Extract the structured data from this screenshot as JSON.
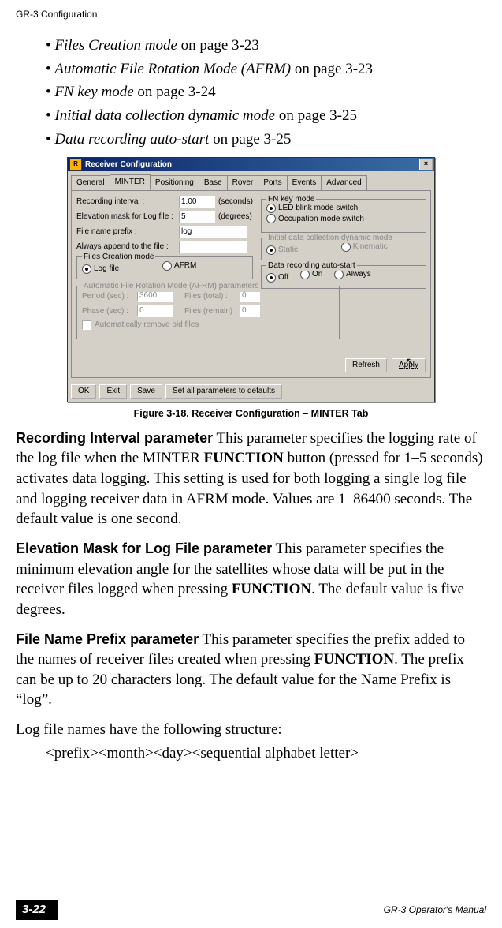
{
  "header": {
    "running": "GR-3 Configuration"
  },
  "bullets": [
    {
      "term": "Files Creation mode",
      "rest": " on page 3-23"
    },
    {
      "term": "Automatic File Rotation Mode (AFRM)",
      "rest": " on page 3-23"
    },
    {
      "term": "FN key mode",
      "rest": " on page 3-24"
    },
    {
      "term": "Initial data collection dynamic mode",
      "rest": " on page 3-25"
    },
    {
      "term": "Data recording auto-start",
      "rest": " on page 3-25"
    }
  ],
  "dialog": {
    "title": "Receiver Configuration",
    "close": "×",
    "tabs": [
      "General",
      "MINTER",
      "Positioning",
      "Base",
      "Rover",
      "Ports",
      "Events",
      "Advanced"
    ],
    "active_tab": 1,
    "left": {
      "rec_int_lbl": "Recording interval :",
      "rec_int_val": "1.00",
      "rec_int_unit": "(seconds)",
      "elev_lbl": "Elevation mask for Log file :",
      "elev_val": "5",
      "elev_unit": "(degrees)",
      "prefix_lbl": "File name prefix :",
      "prefix_val": "log",
      "append_lbl": "Always append to the file :",
      "append_val": ""
    },
    "files_creation": {
      "legend": "Files Creation mode",
      "opt1": "Log file",
      "opt2": "AFRM"
    },
    "afrm": {
      "legend": "Automatic File Rotation Mode (AFRM) parameters",
      "period_lbl": "Period (sec) :",
      "period_val": "3600",
      "total_lbl": "Files (total) :",
      "total_val": "0",
      "phase_lbl": "Phase (sec) :",
      "phase_val": "0",
      "remain_lbl": "Files (remain) :",
      "remain_val": "0",
      "auto_remove": "Automatically remove old files"
    },
    "fn": {
      "legend": "FN key mode",
      "opt1": "LED blink mode switch",
      "opt2": "Occupation mode switch"
    },
    "initdyn": {
      "legend": "Initial data collection dynamic mode",
      "opt1": "Static",
      "opt2": "Kinematic"
    },
    "autostart": {
      "legend": "Data recording auto-start",
      "opt1": "Off",
      "opt2": "On",
      "opt3": "Always"
    },
    "refresh": "Refresh",
    "apply": "Apply",
    "bottom": {
      "ok": "OK",
      "exit": "Exit",
      "save": "Save",
      "defaults": "Set all parameters to defaults"
    }
  },
  "caption": "Figure 3-18. Receiver Configuration – MINTER Tab",
  "p1": {
    "lead": "Recording Interval parameter",
    "t1": " This parameter specifies the logging rate of the log file when the MINTER ",
    "b1": "FUNCTION",
    "t2": " button (pressed for 1–5 seconds) activates data logging. This setting is used for both logging a single log file and logging receiver data in AFRM mode. Values are 1–86400 seconds. The default value is one second."
  },
  "p2": {
    "lead": "Elevation Mask for Log File parameter",
    "t1": " This parameter specifies the minimum elevation angle for the satellites whose data will be put in the receiver files logged when pressing ",
    "b1": "FUNCTION",
    "t2": ". The default value is five degrees."
  },
  "p3": {
    "lead": "File Name Prefix parameter",
    "t1": " This parameter specifies the prefix added to the names of receiver files created when pressing ",
    "b1": "FUNCTION",
    "t2": ". The prefix can be up to 20 characters long. The default value for the Name Prefix is “log”."
  },
  "p4": "Log file names have the following structure:",
  "p5": "<prefix><month><day><sequential alphabet letter>",
  "footer": {
    "page": "3-22",
    "manual": "GR-3 Operator's Manual"
  }
}
